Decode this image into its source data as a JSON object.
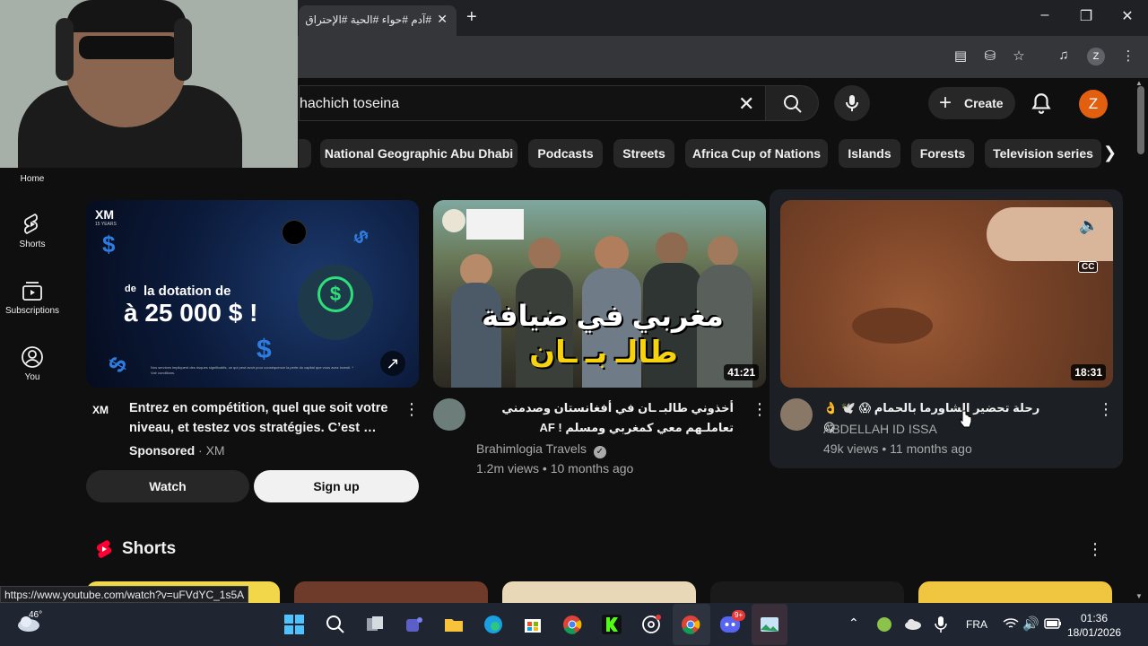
{
  "browser": {
    "tab_title": "#آدم #حواء #الحية #الإحتراق -",
    "close_tab": "✕",
    "new_tab": "+",
    "profile_initial": "Z"
  },
  "youtube": {
    "search_query": "hachich toseina",
    "create_label": "Create",
    "avatar_initial": "Z",
    "chips": [
      "National Geographic Abu Dhabi",
      "Podcasts",
      "Streets",
      "Africa Cup of Nations",
      "Islands",
      "Forests",
      "Television series"
    ],
    "sidebar": [
      {
        "label": "Home"
      },
      {
        "label": "Shorts"
      },
      {
        "label": "Subscriptions"
      },
      {
        "label": "You"
      }
    ],
    "ad": {
      "brand": "XM",
      "brand_sub": "15 YEARS",
      "thumb_small": "de",
      "thumb_line1": "la dotation de",
      "thumb_line2": "à 25 000 $ !",
      "disclaimer": "Nos services impliquent des risques significatifs, ce qui peut avoir pour conséquence la perte du capital que vous avez investi. * Voir conditions.",
      "title": "Entrez en compétition, quel que soit votre niveau, et testez vos stratégies. C’est …",
      "sponsored": "Sponsored",
      "sponsor_name": "XM",
      "watch_label": "Watch",
      "signup_label": "Sign up"
    },
    "videos": [
      {
        "title": "أخذوني طالبـ ـان في أفغانستان وصدمني تعاملـهم معي كمغربي ومسلم ! AF",
        "thumb_text_1": "مغربي في ضيافة",
        "thumb_text_2": "طالـ بـ ـان",
        "channel": "Brahimlogia Travels",
        "views": "1.2m views",
        "age": "10 months ago",
        "duration": "41:21"
      },
      {
        "title": "رحلة تحضير الشاورما بالحمام 😱 🕊️ 👌 😋",
        "channel": "ABDELLAH ID ISSA",
        "views": "49k views",
        "age": "11 months ago",
        "duration": "18:31",
        "cc": "CC"
      }
    ],
    "shorts_title": "Shorts"
  },
  "status_url": "https://www.youtube.com/watch?v=uFVdYC_1s5A",
  "taskbar": {
    "weather": "46°",
    "language": "FRA",
    "time": "01:36",
    "date": "18/01/2026",
    "discord_badge": "9+"
  },
  "colors": {
    "bg": "#0f0f0f",
    "chip": "#272727",
    "accent_red": "#ff0033",
    "avatar": "#e25f10"
  }
}
